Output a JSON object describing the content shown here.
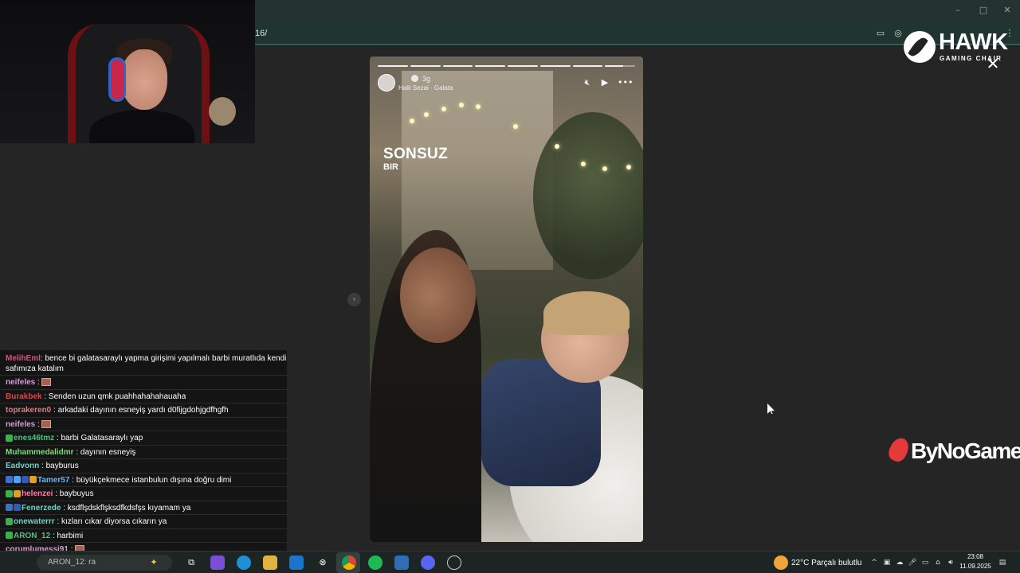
{
  "browser": {
    "url_fragment": "16/"
  },
  "story": {
    "segments": 8,
    "current_segment_progress": 0.6,
    "username": "",
    "time_ago": "3g",
    "music": "Halil Sezai · Galata",
    "title": "SONSUZ",
    "subtitle": "BIR"
  },
  "overlays": {
    "hawk_title": "HAWK",
    "hawk_subtitle": "GAMING CHAIR",
    "bynogame": "ByNoGame",
    "close_glyph": "✕",
    "prev_glyph": "‹"
  },
  "chat": {
    "messages": [
      {
        "user": "MelihEml",
        "text": ": bence bi galatasaraylı yapma girişimi yapılmalı barbi muratlıda kendi",
        "color": "#c75b7a",
        "text2": "safımıza katalım"
      },
      {
        "user": "neifeles",
        "text": " :",
        "color": "#d59bd6",
        "emote": true
      },
      {
        "user": "Burakbek",
        "text": " : Senden uzun qmk puahhahahahauaha",
        "color": "#d74a4a"
      },
      {
        "user": "toprakeren0",
        "text": " : arkadaki dayının esneyiş yardı d0fijgdohjgdfhgfh",
        "color": "#e07c7c"
      },
      {
        "user": "neifeles",
        "text": " :",
        "color": "#d59bd6",
        "emote": true
      },
      {
        "user": "enes46tmz",
        "text": " : barbi Galatasaraylı yap",
        "color": "#4ec27a",
        "badge": [
          "#37b24d"
        ]
      },
      {
        "user": "Muhammedalidmr",
        "text": " : dayının esneyiş",
        "color": "#7fd67f"
      },
      {
        "user": "Eadvonn",
        "text": " : bayburus",
        "color": "#6fd1c8"
      },
      {
        "user": "Tamer57",
        "text": " : büyükçekmece istanbulun dışına doğru dimi",
        "color": "#5fb7ff",
        "badge": [
          "#3b6fd6",
          "#4aa3ff",
          "#2f5bbf",
          "#e0a020"
        ]
      },
      {
        "user": "helenzei",
        "text": " : baybuyus",
        "color": "#ff7aa8",
        "badge": [
          "#37b24d",
          "#e0a020"
        ]
      },
      {
        "user": "Fenerzede",
        "text": " : ksdflşdskflşksdfkdsfşs kıyamam ya",
        "color": "#6fd1c8",
        "badge": [
          "#3b6fd6",
          "#2f5bbf"
        ]
      },
      {
        "user": "onewaterrr",
        "text": " : kızları cıkar diyorsa cıkarın ya",
        "color": "#6fd1c8",
        "badge": [
          "#37b24d"
        ]
      },
      {
        "user": "ARON_12",
        "text": " : harbimi",
        "color": "#4ec27a",
        "badge": [
          "#37b24d"
        ]
      },
      {
        "user": "corumlumessi91",
        "text": " :",
        "color": "#d59bd6",
        "emote": true
      }
    ]
  },
  "taskbar": {
    "search_text": "ARON_12: ra",
    "weather": "22°C  Parçalı bulutlu",
    "time": "23:08",
    "date": "11.09.2025"
  },
  "colors": {
    "page_bg": "#252525",
    "chrome_green": "#2f5b50"
  }
}
